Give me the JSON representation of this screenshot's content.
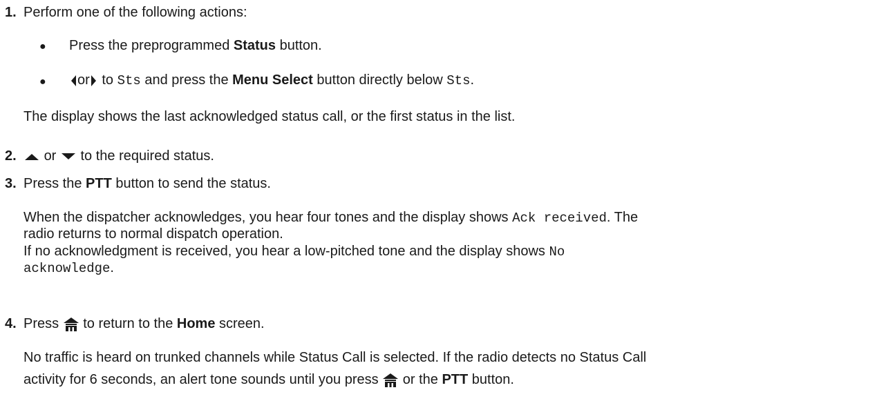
{
  "steps": [
    {
      "number": "1.",
      "text": "Perform one of the following actions:",
      "bullets": [
        {
          "pre": "Press the preprogrammed ",
          "bold": "Status",
          "post": " button."
        },
        {
          "or": "or",
          "to": " to ",
          "code1": "Sts",
          "mid": " and press the ",
          "bold": "Menu Select",
          "post": " button directly below ",
          "code2": "Sts",
          "end": "."
        }
      ],
      "result": "The display shows the last acknowledged status call, or the first status in the list."
    },
    {
      "number": "2.",
      "or": "or",
      "text": " to the required status."
    },
    {
      "number": "3.",
      "pre": "Press the ",
      "bold": "PTT",
      "post": " button to send the status.",
      "result1_pre": "When the dispatcher acknowledges, you hear four tones and the display shows ",
      "result1_code": "Ack received",
      "result1_post": ". The",
      "result1_line2": "radio returns to normal dispatch operation.",
      "result2_pre": "If no acknowledgment is received, you hear a low-pitched tone and the display shows ",
      "result2_code1": "No",
      "result2_code2": "acknowledge",
      "result2_end": "."
    },
    {
      "number": "4.",
      "pre": "Press ",
      "post": " to return to the ",
      "bold": "Home",
      "end": " screen.",
      "result_line1": "No traffic is heard on trunked channels while Status Call is selected. If the radio detects no Status Call",
      "result_line2_pre": "activity for 6 seconds, an alert tone sounds until you press ",
      "result_line2_or": " or the ",
      "result_line2_bold": "PTT",
      "result_line2_end": " button."
    }
  ],
  "icons": {
    "left": "left-arrow-icon",
    "right": "right-arrow-icon",
    "up": "up-arrow-icon",
    "down": "down-arrow-icon",
    "home": "home-icon"
  }
}
